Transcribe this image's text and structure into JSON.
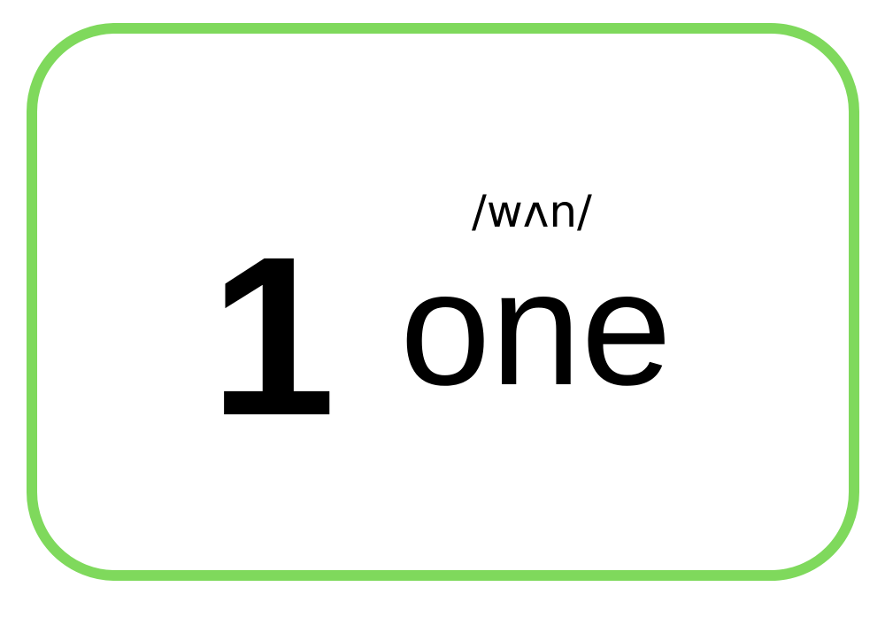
{
  "card": {
    "border_color": "#7fd95c",
    "numeral": "1",
    "phonetic": "/wʌn/",
    "word": "one"
  }
}
